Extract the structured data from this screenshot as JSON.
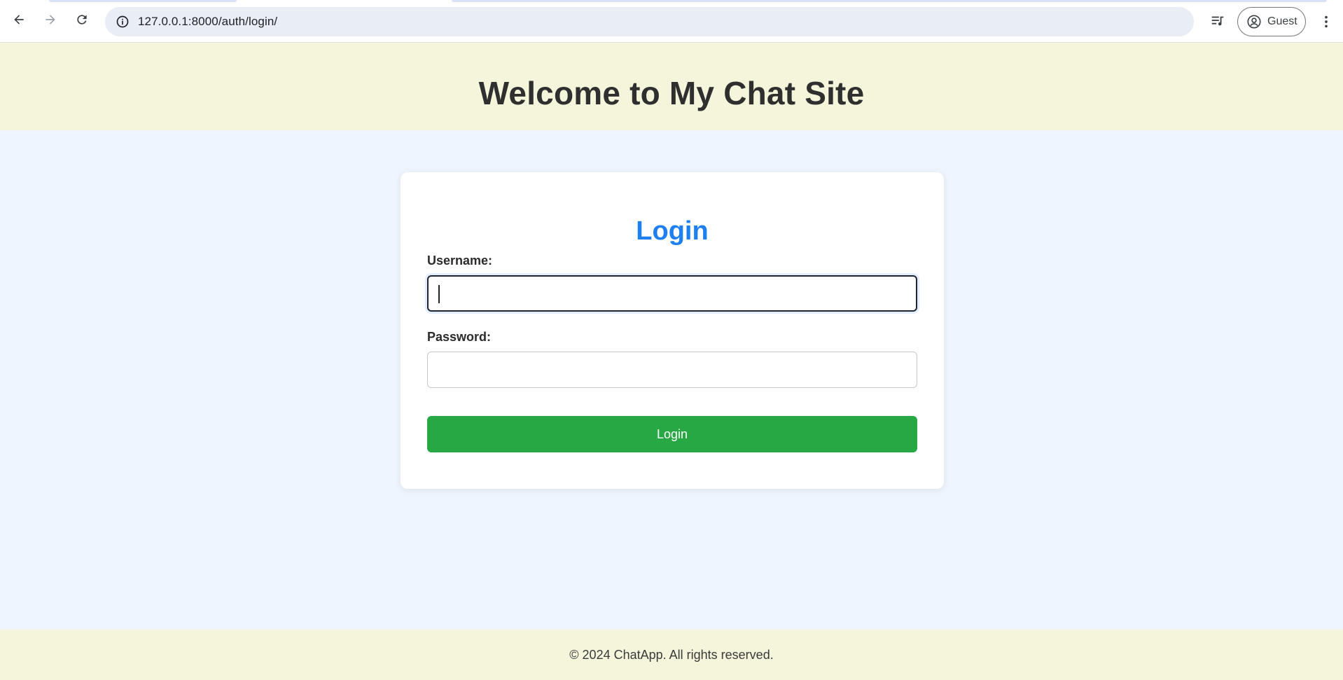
{
  "browser": {
    "url": "127.0.0.1:8000/auth/login/",
    "profile_label": "Guest"
  },
  "header": {
    "title": "Welcome to My Chat Site"
  },
  "login_form": {
    "heading": "Login",
    "username_label": "Username:",
    "username_value": "",
    "password_label": "Password:",
    "password_value": "",
    "submit_label": "Login"
  },
  "footer": {
    "text": "© 2024 ChatApp. All rights reserved."
  },
  "colors": {
    "header_bg": "#f5f5dc",
    "page_bg": "#eef5fe",
    "heading_blue": "#1e7ff0",
    "button_green": "#28a745"
  },
  "icons": {
    "back": "arrow-left-icon",
    "forward": "arrow-right-icon",
    "reload": "reload-icon",
    "site_info": "info-icon",
    "media": "media-queue-icon",
    "profile": "account-circle-icon",
    "menu": "kebab-menu-icon"
  }
}
